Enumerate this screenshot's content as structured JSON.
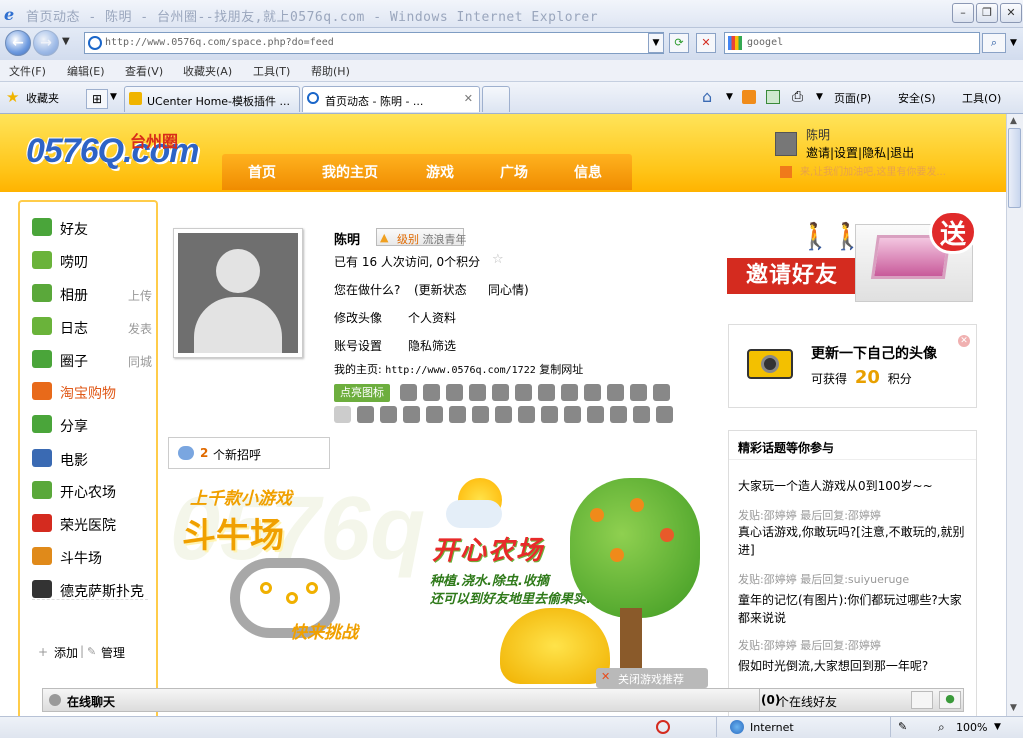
{
  "window": {
    "title": "首页动态 - 陈明 - 台州圈--找朋友,就上0576q.com - Windows Internet Explorer"
  },
  "browser": {
    "address": "http://www.0576q.com/space.php?do=feed",
    "search_placeholder": "googel",
    "menu": [
      "文件(F)",
      "编辑(E)",
      "查看(V)",
      "收藏夹(A)",
      "工具(T)",
      "帮助(H)"
    ],
    "favorites_label": "收藏夹",
    "tabs": [
      {
        "label": "UCenter Home-模板插件 ..."
      },
      {
        "label": "首页动态 - 陈明 - ..."
      }
    ],
    "tools": {
      "page": "页面(P)",
      "safety": "安全(S)",
      "tools": "工具(O)"
    },
    "status": {
      "zone": "Internet",
      "zoom": "100%"
    }
  },
  "site": {
    "logo": "0576Q.com",
    "logo_sub": "台州圈",
    "nav": [
      "首页",
      "我的主页",
      "游戏",
      "广场",
      "信息"
    ],
    "user": {
      "name": "陈明",
      "links": "邀请|设置|隐私|退出",
      "notice": "来,让我们加油吧,这里有你要发..."
    }
  },
  "sidebar": {
    "items": [
      {
        "label": "好友",
        "extra": "",
        "icon": "friends-icon",
        "color": "#4aa53a"
      },
      {
        "label": "唠叨",
        "extra": "",
        "icon": "chat-icon",
        "color": "#6ab33a"
      },
      {
        "label": "相册",
        "extra": "上传",
        "icon": "camera-icon",
        "color": "#5aa83a"
      },
      {
        "label": "日志",
        "extra": "发表",
        "icon": "blog-icon",
        "color": "#6ab33a"
      },
      {
        "label": "圈子",
        "extra": "同城",
        "icon": "group-icon",
        "color": "#4aa53a"
      },
      {
        "label": "淘宝购物",
        "extra": "",
        "icon": "taobao-icon",
        "color": "#e86a1a"
      },
      {
        "label": "分享",
        "extra": "",
        "icon": "share-icon",
        "color": "#4aa53a"
      },
      {
        "label": "电影",
        "extra": "",
        "icon": "movie-icon",
        "color": "#3a6ab3"
      },
      {
        "label": "开心农场",
        "extra": "",
        "icon": "farm-icon",
        "color": "#5aa83a"
      },
      {
        "label": "荣光医院",
        "extra": "",
        "icon": "hospital-icon",
        "color": "#d42b1f"
      },
      {
        "label": "斗牛场",
        "extra": "",
        "icon": "bull-icon",
        "color": "#e08a1a"
      },
      {
        "label": "德克萨斯扑克",
        "extra": "",
        "icon": "poker-icon",
        "color": "#333333"
      }
    ],
    "add_label": "添加",
    "manage_label": "管理"
  },
  "profile": {
    "name": "陈明",
    "level_label": "级别",
    "level_value": "流浪青年",
    "stats": "已有 16 人次访问, 0个积分",
    "status_question": "您在做什么?",
    "update_status": "(更新状态",
    "same_mood": "同心情)",
    "edit_avatar": "修改头像",
    "profile_info": "个人资料",
    "account_settings": "账号设置",
    "privacy_filter": "隐私筛选",
    "homepage_label": "我的主页:",
    "homepage_url": "http://www.0576q.com/1722",
    "copy_url": "复制网址",
    "highlight_button": "点亮图标",
    "greetings_count": "2",
    "greetings_label": "个新招呼"
  },
  "banner": {
    "top_line": "上千款小游戏",
    "game_title": "斗牛场",
    "play_now": "快来挑战",
    "farm_title": "开心农场",
    "farm_line1": "种植.浇水.除虫.收摘",
    "farm_line2": "还可以到好友地里去偷果实...",
    "close_label": "关闭游戏推荐"
  },
  "right": {
    "invite_label": "邀请好友",
    "gift_label": "送",
    "update_title": "更新一下自己的头像",
    "earn_prefix": "可获得",
    "earn_points": "20",
    "earn_suffix": "积分",
    "topics_title": "精彩话题等你参与",
    "topics": [
      {
        "title": "大家玩一个造人游戏从0到100岁~~",
        "meta": "发贴:邵婷婷  最后回复:邵婷婷"
      },
      {
        "title": "真心话游戏,你敢玩吗?[注意,不敢玩的,就别进]",
        "meta": "发贴:邵婷婷  最后回复:suiyueruge"
      },
      {
        "title": "童年的记忆(有图片):你们都玩过哪些?大家都来说说",
        "meta": "发贴:邵婷婷  最后回复:邵婷婷"
      },
      {
        "title": "假如时光倒流,大家想回到那一年呢?",
        "meta": ""
      }
    ]
  },
  "chat": {
    "title": "在线聊天",
    "online_count": "(0)",
    "online_label": "个在线好友"
  }
}
